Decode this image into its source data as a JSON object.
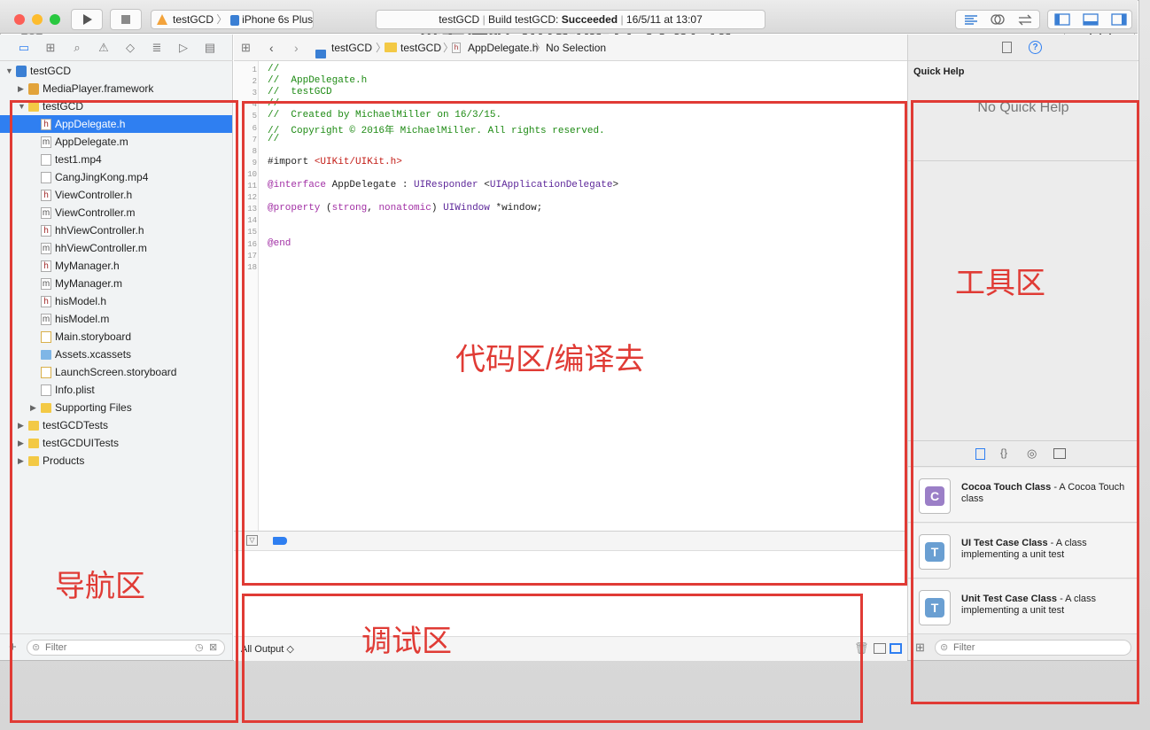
{
  "outer": {
    "title": "屏幕快照 2016-05-17 22.57.15"
  },
  "toolbar": {
    "scheme_target": "testGCD",
    "scheme_device": "iPhone 6s Plus",
    "status_project": "testGCD",
    "status_build_prefix": "Build testGCD:",
    "status_build_result": "Succeeded",
    "status_time": "16/5/11 at 13:07"
  },
  "navigator": {
    "rows": [
      {
        "label": "testGCD",
        "indent": 0,
        "icon": "project",
        "disclosure": "open"
      },
      {
        "label": "MediaPlayer.framework",
        "indent": 1,
        "icon": "framework",
        "disclosure": "closed"
      },
      {
        "label": "testGCD",
        "indent": 1,
        "icon": "folder",
        "disclosure": "open"
      },
      {
        "label": "AppDelegate.h",
        "indent": 2,
        "icon": "h",
        "selected": true
      },
      {
        "label": "AppDelegate.m",
        "indent": 2,
        "icon": "m"
      },
      {
        "label": "test1.mp4",
        "indent": 2,
        "icon": "file"
      },
      {
        "label": "CangJingKong.mp4",
        "indent": 2,
        "icon": "file"
      },
      {
        "label": "ViewController.h",
        "indent": 2,
        "icon": "h"
      },
      {
        "label": "ViewController.m",
        "indent": 2,
        "icon": "m"
      },
      {
        "label": "hhViewController.h",
        "indent": 2,
        "icon": "h"
      },
      {
        "label": "hhViewController.m",
        "indent": 2,
        "icon": "m"
      },
      {
        "label": "MyManager.h",
        "indent": 2,
        "icon": "h"
      },
      {
        "label": "MyManager.m",
        "indent": 2,
        "icon": "m"
      },
      {
        "label": "hisModel.h",
        "indent": 2,
        "icon": "h"
      },
      {
        "label": "hisModel.m",
        "indent": 2,
        "icon": "m"
      },
      {
        "label": "Main.storyboard",
        "indent": 2,
        "icon": "storyboard"
      },
      {
        "label": "Assets.xcassets",
        "indent": 2,
        "icon": "assets"
      },
      {
        "label": "LaunchScreen.storyboard",
        "indent": 2,
        "icon": "storyboard"
      },
      {
        "label": "Info.plist",
        "indent": 2,
        "icon": "file"
      },
      {
        "label": "Supporting Files",
        "indent": 2,
        "icon": "folder",
        "disclosure": "closed"
      },
      {
        "label": "testGCDTests",
        "indent": 1,
        "icon": "folder",
        "disclosure": "closed"
      },
      {
        "label": "testGCDUITests",
        "indent": 1,
        "icon": "folder",
        "disclosure": "closed"
      },
      {
        "label": "Products",
        "indent": 1,
        "icon": "folder",
        "disclosure": "closed"
      }
    ],
    "filter_placeholder": "Filter",
    "add_label": "+"
  },
  "editor": {
    "jump_bar": [
      "testGCD",
      "testGCD",
      "AppDelegate.h",
      "No Selection"
    ],
    "lines": [
      [
        {
          "t": "//",
          "c": "cm"
        }
      ],
      [
        {
          "t": "//  AppDelegate.h",
          "c": "cm"
        }
      ],
      [
        {
          "t": "//  testGCD",
          "c": "cm"
        }
      ],
      [
        {
          "t": "//",
          "c": "cm"
        }
      ],
      [
        {
          "t": "//  Created by MichaelMiller on 16/3/15.",
          "c": "cm"
        }
      ],
      [
        {
          "t": "//  Copyright © 2016年 MichaelMiller. All rights reserved.",
          "c": "cm"
        }
      ],
      [
        {
          "t": "//",
          "c": "cm"
        }
      ],
      [],
      [
        {
          "t": "#import ",
          "c": "pl"
        },
        {
          "t": "<UIKit/UIKit.h>",
          "c": "st"
        }
      ],
      [],
      [
        {
          "t": "@interface",
          "c": "kw"
        },
        {
          "t": " AppDelegate : ",
          "c": "pl"
        },
        {
          "t": "UIResponder",
          "c": "ty"
        },
        {
          "t": " <",
          "c": "pl"
        },
        {
          "t": "UIApplicationDelegate",
          "c": "ty"
        },
        {
          "t": ">",
          "c": "pl"
        }
      ],
      [],
      [
        {
          "t": "@property",
          "c": "kw"
        },
        {
          "t": " (",
          "c": "pl"
        },
        {
          "t": "strong",
          "c": "kw"
        },
        {
          "t": ", ",
          "c": "pl"
        },
        {
          "t": "nonatomic",
          "c": "kw"
        },
        {
          "t": ") ",
          "c": "pl"
        },
        {
          "t": "UIWindow",
          "c": "ty"
        },
        {
          "t": " *window;",
          "c": "pl"
        }
      ],
      [],
      [],
      [
        {
          "t": "@end",
          "c": "kw"
        }
      ],
      [],
      []
    ]
  },
  "debug": {
    "output_label": "All Output ◇"
  },
  "inspector": {
    "quick_help_title": "Quick Help",
    "no_quick_help": "No Quick Help",
    "library": [
      {
        "name": "Cocoa Touch Class",
        "desc": " - A Cocoa Touch class",
        "letter": "C",
        "color": "#9b7fc7"
      },
      {
        "name": "UI Test Case Class",
        "desc": " - A class implementing a unit test",
        "letter": "T",
        "color": "#6a9fd2"
      },
      {
        "name": "Unit Test Case Class",
        "desc": " - A class implementing a unit test",
        "letter": "T",
        "color": "#6a9fd2"
      }
    ],
    "filter_placeholder": "Filter"
  },
  "annotations": {
    "navigator": "导航区",
    "editor": "代码区/编译去",
    "debug": "调试区",
    "utilities": "工具区"
  },
  "colors": {
    "accent": "#2f7ff1",
    "annotation": "#e03b35",
    "success_text": "#222222"
  }
}
